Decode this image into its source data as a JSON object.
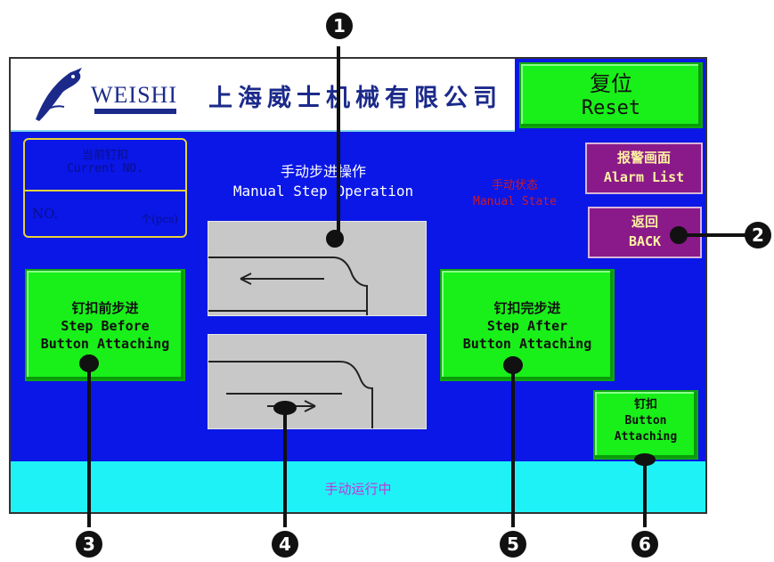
{
  "header": {
    "brand": "WEISHI",
    "company": "上海威士机械有限公司"
  },
  "reset_button": {
    "zh": "复位",
    "en": "Reset"
  },
  "counter": {
    "label_zh": "当前钉扣",
    "label_en": "Current NO.",
    "no_label": "NO.",
    "unit": "个(pcs)"
  },
  "title": {
    "zh": "手动步进操作",
    "en": "Manual Step Operation"
  },
  "manual_state": {
    "zh": "手动状态",
    "en": "Manual State"
  },
  "alarm_button": {
    "zh": "报警画面",
    "en": "Alarm List"
  },
  "back_button": {
    "zh": "返回",
    "en": "BACK"
  },
  "step_before_button": {
    "zh": "钉扣前步进",
    "en1": "Step Before",
    "en2": "Button Attaching"
  },
  "step_after_button": {
    "zh": "钉扣完步进",
    "en1": "Step After",
    "en2": "Button Attaching"
  },
  "attach_button": {
    "zh": "钉扣",
    "en1": "Button",
    "en2": "Attaching"
  },
  "status": {
    "text": "手动运行中"
  },
  "callouts": [
    "1",
    "2",
    "3",
    "4",
    "5",
    "6"
  ],
  "colors": {
    "screen_bg": "#0a17e6",
    "button_green": "#19f019",
    "button_purple": "#8a1a8a",
    "status_bar": "#1ff2f6",
    "state_red": "#cc1a2a"
  },
  "icons": {
    "logo": "bird-logo-icon"
  }
}
